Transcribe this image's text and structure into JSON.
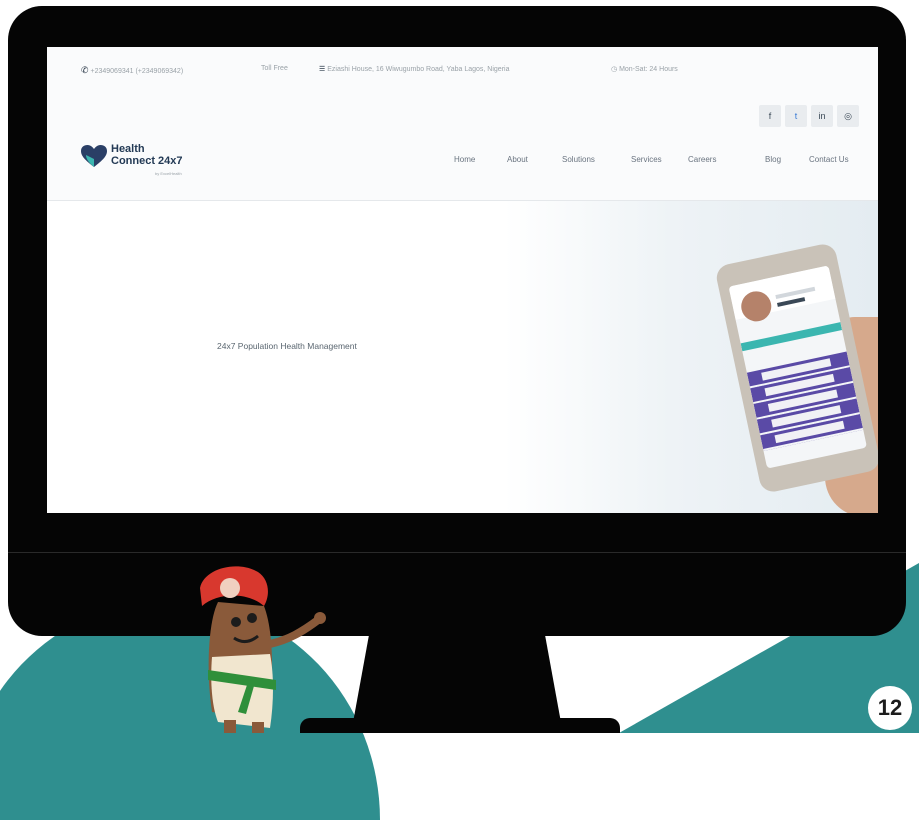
{
  "topbar": {
    "phone": "+2349069341 (+2349069342)",
    "toll_free": "Toll Free",
    "address": "Eziashi House, 16 Wiwugumbo Road, Yaba Lagos, Nigeria",
    "hours": "Mon-Sat: 24 Hours"
  },
  "social": [
    {
      "name": "facebook-icon",
      "glyph": "f"
    },
    {
      "name": "twitter-icon",
      "glyph": "t"
    },
    {
      "name": "linkedin-icon",
      "glyph": "in"
    },
    {
      "name": "instagram-icon",
      "glyph": "◎"
    }
  ],
  "logo": {
    "line1": "Health",
    "line2": "Connect 24x7",
    "tagline": "by ExcelHealth"
  },
  "nav": [
    "Home",
    "About",
    "Solutions",
    "Services",
    "Careers",
    "Blog",
    "Contact Us"
  ],
  "hero": {
    "title": "24x7 Population Health Management"
  },
  "slide_number": "12",
  "colors": {
    "accent_teal": "#2f8f8f",
    "brand_navy": "#233a55",
    "phone_teal": "#3bb6b0",
    "phone_purple": "#5a4aa6"
  }
}
